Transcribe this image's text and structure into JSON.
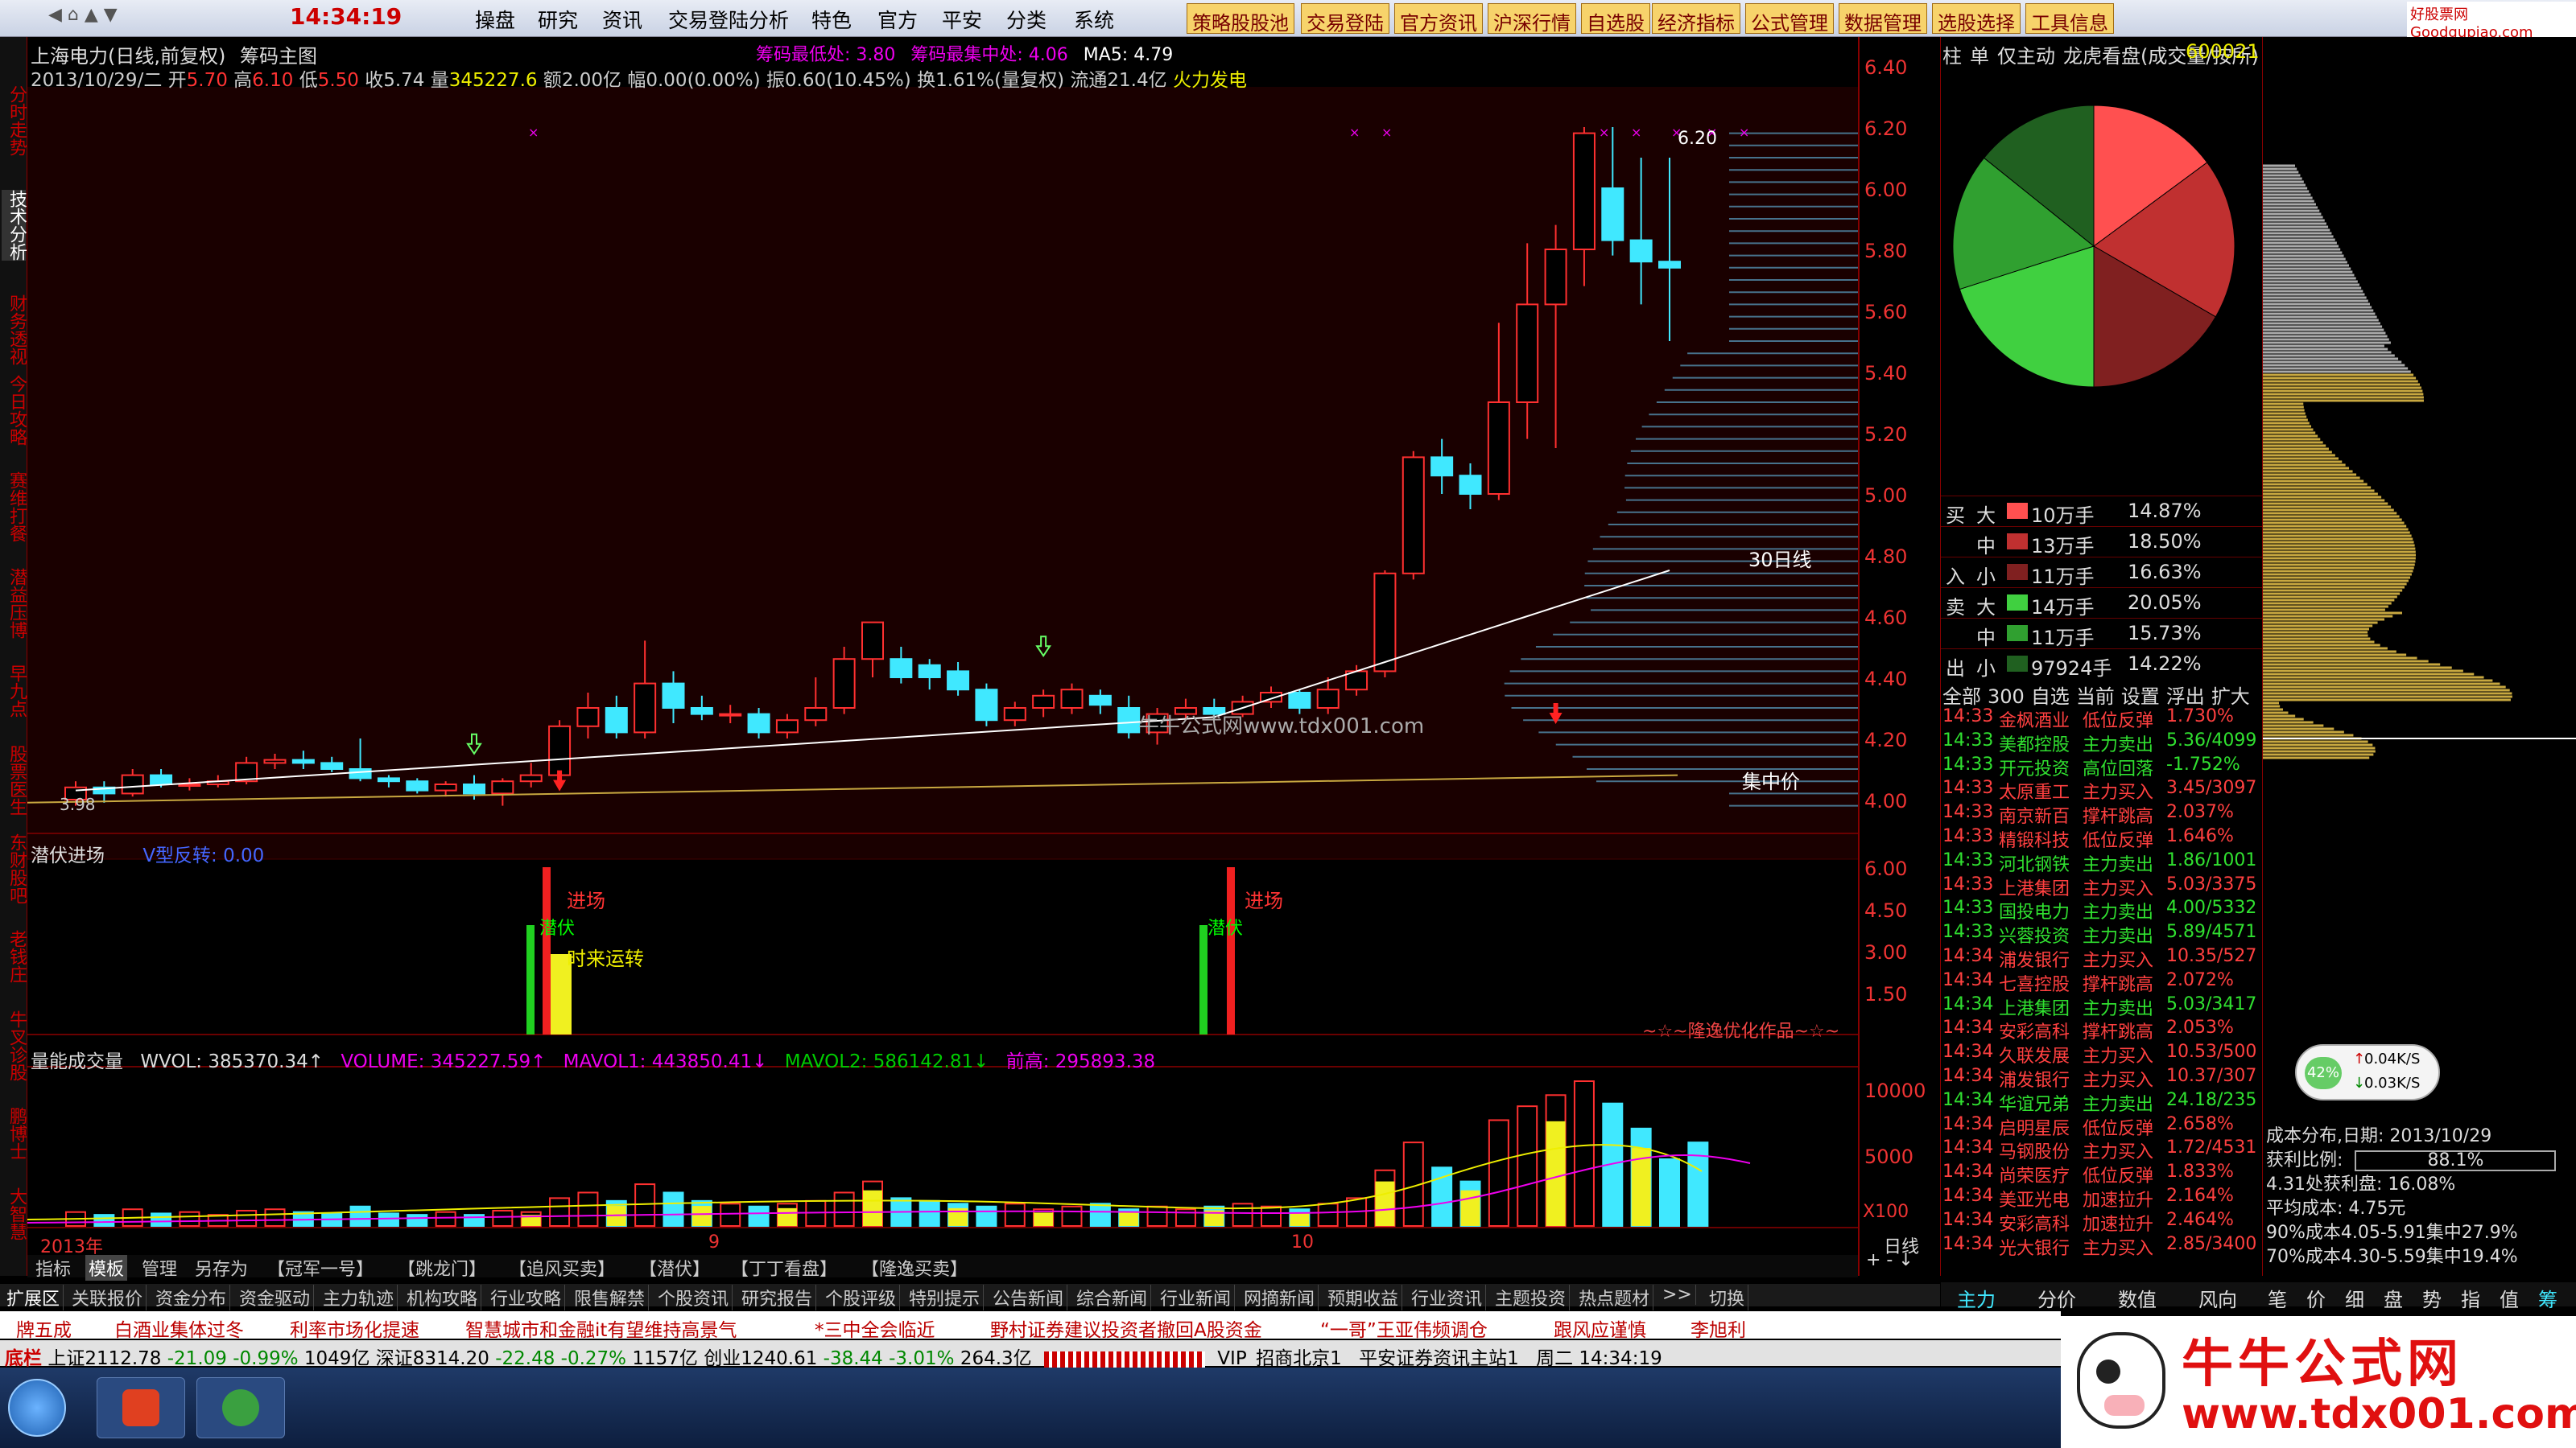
{
  "clock": "14:34:19",
  "topnav": [
    "操盘",
    "研究",
    "资讯",
    "交易登陆分析",
    "特色",
    "官方",
    "平安",
    "分类",
    "系统"
  ],
  "toolbar": [
    "策略股股池",
    "交易登陆",
    "官方资讯",
    "沪深行情",
    "自选股",
    "经济指标",
    "公式管理",
    "数据管理",
    "选股选择",
    "工具信息"
  ],
  "brand": "好股票网 Goodgupiao.com",
  "lefttabs": [
    "分时走势",
    "技术分析",
    "财务透视",
    "今日攻略",
    "赛维打餐",
    "潜益压博",
    "早九点",
    "股票医生",
    "东财股吧",
    "老钱庄",
    "牛叉诊股",
    "鹏博士",
    "大智慧"
  ],
  "stock": {
    "name": "上海电力(日线,前复权)",
    "indicator": "筹码主图",
    "date": "2013/10/29/二",
    "open_label": "开",
    "open": "5.70",
    "high_label": "高",
    "high": "6.10",
    "low_label": "低",
    "low": "5.50",
    "close_label": "收",
    "close": "5.74",
    "vol_label": "量",
    "vol": "345227.6",
    "amt_label": "额",
    "amt": "2.00亿",
    "chg": "幅0.00(0.00%)",
    "amp": "振0.60(10.45%)",
    "turn": "换1.61%(量复权)",
    "float": "流通21.4亿",
    "concept": "火力发电",
    "chip_low": "筹码最低处: 3.80",
    "chip_conc": "筹码最集中处: 4.06",
    "ma5": "MA5: 4.79",
    "peak": "6.20",
    "bottom": "3.98",
    "ma30_label": "30日线",
    "jzj_label": "集中价",
    "overlay": "牛牛公式网www.tdx001.com",
    "year": "2013年",
    "month9": "9",
    "month10": "10"
  },
  "price_axis": [
    "6.40",
    "6.20",
    "6.00",
    "5.80",
    "5.60",
    "5.40",
    "5.20",
    "5.00",
    "4.80",
    "4.60",
    "4.40",
    "4.20",
    "4.00"
  ],
  "sub1": {
    "title": "潜伏进场",
    "sub": "V型反转: 0.00",
    "ticks": [
      "6.00",
      "4.50",
      "3.00",
      "1.50"
    ],
    "jc": "进场",
    "qf": "潜伏",
    "slzz": "时来运转",
    "footer": "~☆~隆逸优化作品~☆~"
  },
  "sub2": {
    "title": "量能成交量",
    "wvol": "WVOL: 385370.34↑",
    "volume": "VOLUME: 345227.59↑",
    "mavol1": "MAVOL1: 443850.41↓",
    "mavol2": "MAVOL2: 586142.81↓",
    "prev": "前高: 295893.38",
    "ticks": [
      "10000",
      "5000"
    ],
    "unit": "X100"
  },
  "bottomtabs": [
    "指标",
    "模板",
    "管理",
    "另存为",
    "【冠军一号】",
    "【跳龙门】",
    "【追风买卖】",
    "【潜伏】",
    "【丁丁看盘】",
    "【隆逸买卖】"
  ],
  "daytab": "日线",
  "exttabs": [
    "扩展区",
    "关联报价",
    "资金分布",
    "资金驱动",
    "主力轨迹",
    "机构攻略",
    "行业攻略",
    "限售解禁",
    "个股资讯",
    "研究报告",
    "个股评级",
    "特别提示",
    "公告新闻",
    "综合新闻",
    "行业新闻",
    "网摘新闻",
    "预期收益",
    "行业资讯",
    "主题投资",
    "热点题材",
    ">>",
    "切换"
  ],
  "rpanel": {
    "tabs": [
      "柱",
      "单",
      "仅主动",
      "龙虎看盘(成交量/按所)"
    ],
    "code": "600021",
    "buy_sell_rows": [
      {
        "side": "买",
        "size": "大",
        "vol": "10万手",
        "pct": "14.87%",
        "color": "#ff5050"
      },
      {
        "side": "",
        "size": "中",
        "vol": "13万手",
        "pct": "18.50%",
        "color": "#c03030"
      },
      {
        "side": "入",
        "size": "小",
        "vol": "11万手",
        "pct": "16.63%",
        "color": "#802020"
      },
      {
        "side": "卖",
        "size": "大",
        "vol": "14万手",
        "pct": "20.05%",
        "color": "#40d040"
      },
      {
        "side": "",
        "size": "中",
        "vol": "11万手",
        "pct": "15.73%",
        "color": "#30a030"
      },
      {
        "side": "出",
        "size": "小",
        "vol": "97924手",
        "pct": "14.22%",
        "color": "#206020"
      }
    ],
    "pie": [
      14.87,
      18.5,
      16.63,
      20.05,
      15.73,
      14.22
    ],
    "filter": [
      "全部",
      "300",
      "自选",
      "当前",
      "设置",
      "浮出",
      "扩大"
    ],
    "feed": [
      [
        "14:33",
        "金枫酒业",
        "低位反弹",
        "1.730%"
      ],
      [
        "14:33",
        "美都控股",
        "主力卖出",
        "5.36/4099"
      ],
      [
        "14:33",
        "开元投资",
        "高位回落",
        "-1.752%"
      ],
      [
        "14:33",
        "太原重工",
        "主力买入",
        "3.45/3097"
      ],
      [
        "14:33",
        "南京新百",
        "撑杆跳高",
        "2.037%"
      ],
      [
        "14:33",
        "精锻科技",
        "低位反弹",
        "1.646%"
      ],
      [
        "14:33",
        "河北钢铁",
        "主力卖出",
        "1.86/1001"
      ],
      [
        "14:33",
        "上港集团",
        "主力买入",
        "5.03/3375"
      ],
      [
        "14:33",
        "国投电力",
        "主力卖出",
        "4.00/5332"
      ],
      [
        "14:33",
        "兴蓉投资",
        "主力卖出",
        "5.89/4571"
      ],
      [
        "14:34",
        "浦发银行",
        "主力买入",
        "10.35/527"
      ],
      [
        "14:34",
        "七喜控股",
        "撑杆跳高",
        "2.072%"
      ],
      [
        "14:34",
        "上港集团",
        "主力卖出",
        "5.03/3417"
      ],
      [
        "14:34",
        "安彩高科",
        "撑杆跳高",
        "2.053%"
      ],
      [
        "14:34",
        "久联发展",
        "主力买入",
        "10.53/500"
      ],
      [
        "14:34",
        "浦发银行",
        "主力买入",
        "10.37/307"
      ],
      [
        "14:34",
        "华谊兄弟",
        "主力卖出",
        "24.18/235"
      ],
      [
        "14:34",
        "启明星辰",
        "低位反弹",
        "2.658%"
      ],
      [
        "14:34",
        "马钢股份",
        "主力买入",
        "1.72/4531"
      ],
      [
        "14:34",
        "尚荣医疗",
        "低位反弹",
        "1.833%"
      ],
      [
        "14:34",
        "美亚光电",
        "加速拉升",
        "2.164%"
      ],
      [
        "14:34",
        "安彩高科",
        "加速拉升",
        "2.464%"
      ],
      [
        "14:34",
        "光大银行",
        "主力买入",
        "2.85/3400"
      ]
    ],
    "bottomtabs": [
      "主力",
      "分价",
      "数值",
      "风向"
    ]
  },
  "cdist": {
    "title": "成本分布,日期: 2013/10/29",
    "profit_label": "获利比例:",
    "profit": "88.1%",
    "l1": "4.31处获利盘: 16.08%",
    "l2": "平均成本: 4.75元",
    "l3": "90%成本4.05-5.91集中27.9%",
    "l4": "70%成本4.30-5.59集中19.4%",
    "net_pct": "42%",
    "net_up": "0.04K/S",
    "net_down": "0.03K/S",
    "tabs": [
      "笔",
      "价",
      "细",
      "盘",
      "势",
      "指",
      "值",
      "筹"
    ]
  },
  "news": [
    "牌五成",
    "白酒业集体过冬",
    "利率市场化提速",
    "智慧城市和金融it有望维持高景气",
    "*三中全会临近",
    "野村证券建议投资者撤回A股资金",
    "“一哥”王亚伟频调仓",
    "跟风应谨慎",
    "李旭利"
  ],
  "status": {
    "idx1": "上证2112.78",
    "c1": "-21.09",
    "p1": "-0.99%",
    "a1": "1049亿",
    "idx2": "深证8314.20",
    "c2": "-22.48",
    "p2": "-0.27%",
    "a2": "1157亿",
    "idx3": "创业1240.61",
    "c3": "-38.44",
    "p3": "-3.01%",
    "a3": "264.3亿",
    "vip": "VIP_招商北京1",
    "site": "平安证券资讯主站1",
    "weekday": "周二",
    "time": "14:34:19",
    "bar": "底栏"
  },
  "watermark": {
    "title": "牛牛公式网",
    "url": "www.tdx001.com"
  },
  "colors": {
    "up": "#ff3030",
    "down": "#20e0f0",
    "bg": "#000000",
    "grid": "#800000"
  }
}
